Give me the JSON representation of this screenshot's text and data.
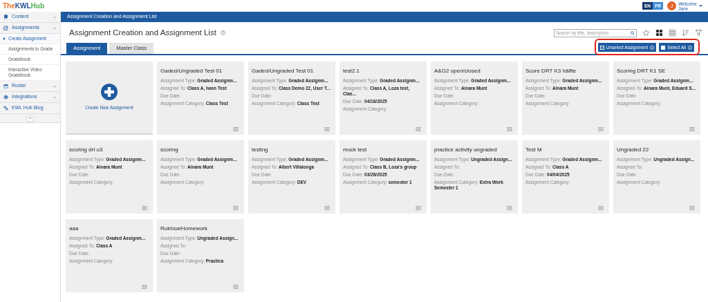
{
  "header": {
    "languages": [
      {
        "label": "EN",
        "selected": true
      },
      {
        "label": "FR",
        "selected": false
      }
    ],
    "user": {
      "initial": "J",
      "greeting": "Welcome",
      "name": "Jane"
    }
  },
  "logo": {
    "parts": [
      {
        "text": "The",
        "color": "#e8742c"
      },
      {
        "text": "KWL",
        "color": "#1e4f96"
      },
      {
        "text": "Hub",
        "color": "#4caf50"
      }
    ]
  },
  "sidebar": {
    "items": [
      {
        "kind": "section",
        "label": "Content"
      },
      {
        "kind": "section",
        "label": "Assignments"
      },
      {
        "kind": "sub",
        "label": "Create Assignment",
        "selected": true
      },
      {
        "kind": "sub",
        "label": "Assignments to Grade",
        "selected": false
      },
      {
        "kind": "sub",
        "label": "Gradebook",
        "selected": false
      },
      {
        "kind": "sub",
        "label": "Interactive Video Gradebook",
        "selected": false
      },
      {
        "kind": "section",
        "label": "Roster"
      },
      {
        "kind": "section",
        "label": "Integrations"
      },
      {
        "kind": "link",
        "label": "KWL Hub Blog"
      }
    ],
    "collapse": "«"
  },
  "breadcrumb": "Assignment Creation and Assignment List",
  "title": "Assignment Creation and Assignment List",
  "search": {
    "placeholder": "Search by title, description"
  },
  "views": [
    {
      "kind": "grid",
      "selected": true
    },
    {
      "kind": "list",
      "selected": false
    }
  ],
  "tabs": [
    {
      "label": "Assignment",
      "selected": true
    },
    {
      "label": "Master Class",
      "selected": false
    }
  ],
  "actions": {
    "highlighted": true,
    "buttons": [
      {
        "label": "Unselect Assignment",
        "checked": true
      },
      {
        "label": "Select All",
        "checked": false
      }
    ]
  },
  "cards": [
    {
      "kind": "create",
      "label": "Create New Assignment"
    },
    {
      "kind": "assignment",
      "title": "Gaded/Ungraded Test 01",
      "fields": [
        {
          "label": "Assignment Type:",
          "value": "Graded Assignm..."
        },
        {
          "label": "Assigned To:",
          "value": "Class A, Iwon Test"
        },
        {
          "label": "Due Date:"
        },
        {
          "label": "Assignment Category:",
          "value": "Class Test"
        }
      ]
    },
    {
      "kind": "assignment",
      "title": "Gaded/Ungraded Test 01",
      "fields": [
        {
          "label": "Assignment Type:",
          "value": "Graded Assignm..."
        },
        {
          "label": "Assigned To:",
          "value": "Class Demo 22, User T..."
        },
        {
          "label": "Due Date:"
        },
        {
          "label": "Assignment Category:",
          "value": "Class Test"
        }
      ]
    },
    {
      "kind": "assignment",
      "title": "test2.1",
      "fields": [
        {
          "label": "Assignment Type:",
          "value": "Graded Assignm..."
        },
        {
          "label": "Assigned To:",
          "value": "Class A, Loza test, Clas..."
        },
        {
          "label": "Due Date:",
          "value": "04/16/2025"
        },
        {
          "label": "Assignment Category:"
        }
      ]
    },
    {
      "kind": "assignment",
      "title": "A&G2 open/closed",
      "fields": [
        {
          "label": "Assignment Type:",
          "value": "Graded Assignm..."
        },
        {
          "label": "Assigned To:",
          "value": "Ainara Munt"
        },
        {
          "label": "Due Date:"
        },
        {
          "label": "Assignment Category:"
        }
      ]
    },
    {
      "kind": "assignment",
      "title": "Score DRT K3 hälfte",
      "fields": [
        {
          "label": "Assignment Type:",
          "value": "Graded Assignm..."
        },
        {
          "label": "Assigned To:",
          "value": "Ainara Munt"
        },
        {
          "label": "Due Date:"
        },
        {
          "label": "Assignment Category:"
        }
      ]
    },
    {
      "kind": "assignment",
      "title": "Scoring DRT K1 SE",
      "fields": [
        {
          "label": "Assignment Type:",
          "value": "Graded Assignm..."
        },
        {
          "label": "Assigned To:",
          "value": "Ainara Munt, Eduard S..."
        },
        {
          "label": "Due Date:"
        },
        {
          "label": "Assignment Category:"
        }
      ]
    },
    {
      "kind": "assignment",
      "title": "scoring drt u3",
      "fields": [
        {
          "label": "Assignment Type:",
          "value": "Graded Assignm..."
        },
        {
          "label": "Assigned To:",
          "value": "Ainara Munt"
        },
        {
          "label": "Due Date:"
        },
        {
          "label": "Assignment Category:"
        }
      ]
    },
    {
      "kind": "assignment",
      "title": "scoring",
      "fields": [
        {
          "label": "Assignment Type:",
          "value": "Graded Assignm..."
        },
        {
          "label": "Assigned To:",
          "value": "Ainara Munt"
        },
        {
          "label": "Due Date:"
        },
        {
          "label": "Assignment Category:"
        }
      ]
    },
    {
      "kind": "assignment",
      "title": "testing",
      "fields": [
        {
          "label": "Assignment Type:",
          "value": "Graded Assignm..."
        },
        {
          "label": "Assigned To:",
          "value": "Albert Villalonga"
        },
        {
          "label": "Due Date:"
        },
        {
          "label": "Assignment Category:",
          "value": "DEV"
        }
      ]
    },
    {
      "kind": "assignment",
      "title": "mock test",
      "fields": [
        {
          "label": "Assignment Type:",
          "value": "Graded Assignm..."
        },
        {
          "label": "Assigned To:",
          "value": "Class B, Loza's group"
        },
        {
          "label": "Due Date:",
          "value": "03/28/2025"
        },
        {
          "label": "Assignment Category:",
          "value": "semester 1"
        }
      ]
    },
    {
      "kind": "assignment",
      "title": "practice activity ungraded",
      "fields": [
        {
          "label": "Assignment Type:",
          "value": "Ungraded Assign..."
        },
        {
          "label": "Assigned To:"
        },
        {
          "label": "Due Date:"
        },
        {
          "label": "Assignment Category:",
          "value": "Extra Work Semester 1"
        }
      ]
    },
    {
      "kind": "assignment",
      "title": "Test M",
      "fields": [
        {
          "label": "Assignment Type:",
          "value": "Graded Assignm..."
        },
        {
          "label": "Assigned To:",
          "value": "Class A"
        },
        {
          "label": "Due Date:",
          "value": "04/04/2025"
        },
        {
          "label": "Assignment Category:"
        }
      ]
    },
    {
      "kind": "assignment",
      "title": "Ungraded 22",
      "fields": [
        {
          "label": "Assignment Type:",
          "value": "Ungraded Assign..."
        },
        {
          "label": "Assigned To:"
        },
        {
          "label": "Due Date:"
        },
        {
          "label": "Assignment Category:"
        }
      ]
    },
    {
      "kind": "assignment",
      "title": "aaa",
      "fields": [
        {
          "label": "Assignment Type:",
          "value": "Graded Assignm..."
        },
        {
          "label": "Assigned To:",
          "value": "Class A"
        },
        {
          "label": "Due Date:"
        },
        {
          "label": "Assignment Category:"
        }
      ]
    },
    {
      "kind": "assignment",
      "title": "RukhsarHomework",
      "fields": [
        {
          "label": "Assignment Type:",
          "value": "Ungraded Assign..."
        },
        {
          "label": "Assigned To:"
        },
        {
          "label": "Due Date:"
        },
        {
          "label": "Assignment Category:",
          "value": "Practica"
        }
      ]
    }
  ]
}
